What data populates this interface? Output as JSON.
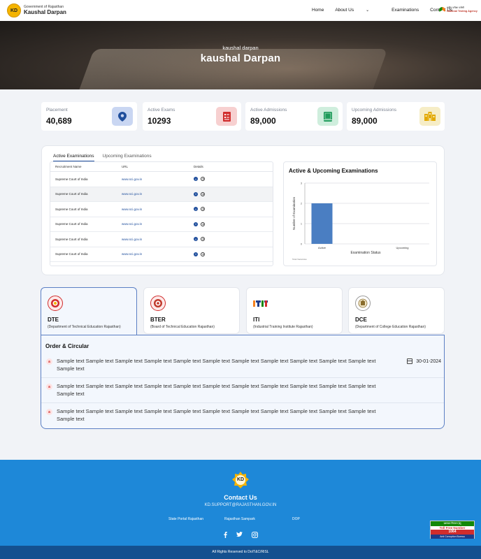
{
  "header": {
    "logo_badge": "KD",
    "logo_small": "Government of Rajasthan",
    "logo_big": "Kaushal Darpan",
    "nav": [
      {
        "label": "Home"
      },
      {
        "label": "About Us"
      },
      {
        "label": "Examinations"
      },
      {
        "label": "Contact Us"
      }
    ],
    "nta_line1": "राष्ट्रीय परीक्षा एजेंसी",
    "nta_line2": "National Testing Agency"
  },
  "hero": {
    "subtitle": "kaushal darpan",
    "title": "kaushal Darpan"
  },
  "stats": [
    {
      "label": "Placement",
      "value": "40,689",
      "icon": "location-pin-icon",
      "icon_bg": "#c9d6f2",
      "icon_color": "#1f4e9c"
    },
    {
      "label": "Active Exams",
      "value": "10293",
      "icon": "exam-sheet-icon",
      "icon_bg": "#f7d0d0",
      "icon_color": "#d12d2d"
    },
    {
      "label": "Active Admissions",
      "value": "89,000",
      "icon": "book-icon",
      "icon_bg": "#cfeedd",
      "icon_color": "#1e9b5a"
    },
    {
      "label": "Upcoming Admissions",
      "value": "89,000",
      "icon": "building-icon",
      "icon_bg": "#f6edc6",
      "icon_color": "#e3a900"
    }
  ],
  "exams": {
    "tabs": [
      {
        "label": "Active Examinations"
      },
      {
        "label": "Upcoming Examinations"
      }
    ],
    "columns": {
      "name": "Recruitment Name",
      "url": "URL",
      "details": "Details"
    },
    "rows": [
      {
        "name": "Supreme Court of India",
        "url": "www.sci.gov.in"
      },
      {
        "name": "Supreme Court of India",
        "url": "www.sci.gov.in"
      },
      {
        "name": "Supreme Court of India",
        "url": "www.sci.gov.in"
      },
      {
        "name": "Supreme Court of India",
        "url": "www.sci.gov.in"
      },
      {
        "name": "Supreme Court of India",
        "url": "www.sci.gov.in"
      },
      {
        "name": "Supreme Court of India",
        "url": "www.sci.gov.in"
      }
    ],
    "info_glyph": "i"
  },
  "chart_data": {
    "type": "bar",
    "title": "Active & Upcoming Examinations",
    "categories": [
      "Active",
      "Upcoming"
    ],
    "values": [
      2,
      0
    ],
    "xlabel": "Examination Status",
    "ylabel": "Number of Examination",
    "yticks": [
      "0",
      "1",
      "2",
      "3"
    ],
    "ylim": [
      0,
      3
    ],
    "grid": true,
    "legend_label": "Total Vacancies",
    "bar_color": "#4a7ec2"
  },
  "departments": [
    {
      "name": "DTE",
      "full": "(Department of Technical Education Rajasthan)",
      "logo": "dte-seal-icon",
      "active": true
    },
    {
      "name": "BTER",
      "full": "(Board of Technical Education Rajasthan)",
      "logo": "bter-seal-icon",
      "active": false
    },
    {
      "name": "ITI",
      "full": "(Industrial Training Institute Rajasthan)",
      "logo": "iti-logo-icon",
      "active": false
    },
    {
      "name": "DCE",
      "full": "(Department of College Education Rajasthan)",
      "logo": "dce-seal-icon",
      "active": false
    }
  ],
  "orders": {
    "title": "Order & Circular",
    "items": [
      {
        "text": "Sample text Sample text Sample text Sample text Sample text Sample text Sample text Sample text Sample text Sample text Sample text Sample text",
        "date": "30-01-2024"
      },
      {
        "text": "Sample text Sample text Sample text Sample text Sample text Sample text Sample text Sample text Sample text Sample text Sample text Sample text",
        "date": ""
      },
      {
        "text": "Sample text Sample text Sample text Sample text Sample text Sample text Sample text Sample text Sample text Sample text Sample text Sample text",
        "date": ""
      }
    ],
    "pdf_glyph": "a"
  },
  "footer": {
    "logo": "KD",
    "contact_title": "Contact Us",
    "email": "KD.SUPPORT@RAJASTHAN.GOV.IN",
    "links": [
      {
        "label": "State Portal Rajasthan"
      },
      {
        "label": "Rajasthan Sampark"
      },
      {
        "label": "DOP"
      }
    ],
    "social": [
      "facebook-icon",
      "twitter-icon",
      "instagram-icon"
    ],
    "copyright": "All Rights Reserved to DoIT&C/RISL"
  },
  "tollfree": {
    "top": "भ्रष्टाचार नियंत्रण हेतु",
    "label": "Toll Free Number",
    "number": "1064",
    "bottom": "Anti Corruption Bureau"
  }
}
